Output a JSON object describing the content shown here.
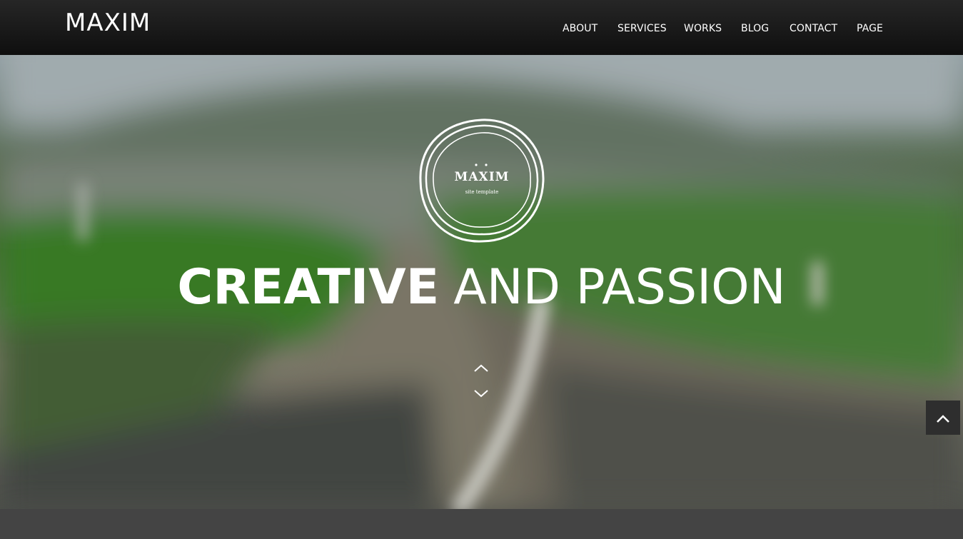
{
  "header": {
    "brand": "MAXIM",
    "nav": [
      "ABOUT",
      "SERVICES",
      "WORKS",
      "BLOG",
      "CONTACT",
      "PAGE"
    ]
  },
  "hero": {
    "logo_title": "MAXIM",
    "logo_subtitle": "site template",
    "headline_bold": "CREATIVE",
    "headline_light": "AND PASSION",
    "scroll_up_icon": "chevron-up-icon",
    "scroll_down_icon": "chevron-down-icon"
  },
  "back_to_top_icon": "chevron-up-icon",
  "colors": {
    "navbar": "#1a1a1a",
    "text": "#ffffff",
    "footer": "#444444",
    "back_to_top": "#2e2e2e"
  }
}
